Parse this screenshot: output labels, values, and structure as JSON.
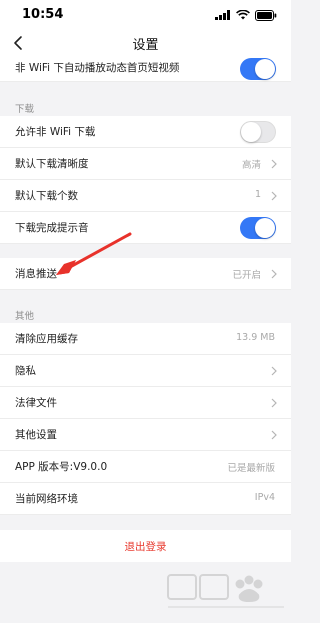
{
  "status_bar": {
    "time": "10:54"
  },
  "nav": {
    "title": "设置"
  },
  "top_row": {
    "label": "非 WiFi 下自动播放动态首页短视频",
    "toggle": "on"
  },
  "download": {
    "header": "下载",
    "items": [
      {
        "label": "允许非 WiFi 下载",
        "toggle": "off"
      },
      {
        "label": "默认下载清晰度",
        "value": "高清"
      },
      {
        "label": "默认下载个数",
        "value": "1"
      },
      {
        "label": "下载完成提示音",
        "toggle": "on"
      }
    ]
  },
  "push": {
    "label": "消息推送",
    "value": "已开启"
  },
  "other": {
    "header": "其他",
    "items": [
      {
        "label": "清除应用缓存",
        "value": "13.9 MB"
      },
      {
        "label": "隐私"
      },
      {
        "label": "法律文件"
      },
      {
        "label": "其他设置"
      },
      {
        "label": "APP 版本号:V9.0.0",
        "value": "已是最新版"
      },
      {
        "label": "当前网络环境",
        "value": "IPv4"
      }
    ]
  },
  "logout": {
    "label": "退出登录"
  },
  "colors": {
    "accent": "#3478f6",
    "danger": "#e8392e",
    "annotation": "#e8322b"
  },
  "icons": [
    "signal-icon",
    "wifi-icon",
    "battery-icon",
    "back-chevron-icon",
    "chevron-right-icon",
    "annotation-arrow",
    "baidu-watermark"
  ]
}
